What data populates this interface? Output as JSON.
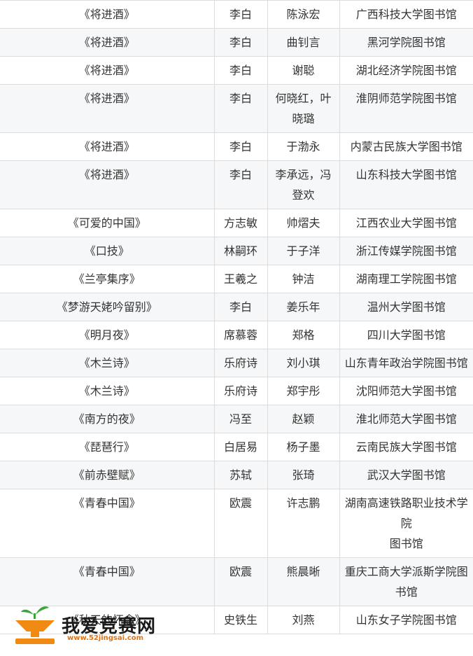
{
  "table": {
    "rows": [
      {
        "title": "《将进酒》",
        "author": "李白",
        "reader": "陈泳宏",
        "library": "广西科技大学图书馆"
      },
      {
        "title": "《将进酒》",
        "author": "李白",
        "reader": "曲钊言",
        "library": "黑河学院图书馆"
      },
      {
        "title": "《将进酒》",
        "author": "李白",
        "reader": "谢聪",
        "library": "湖北经济学院图书馆"
      },
      {
        "title": "《将进酒》",
        "author": "李白",
        "reader": "何晓红，叶晓璐",
        "library": "淮阴师范学院图书馆"
      },
      {
        "title": "《将进酒》",
        "author": "李白",
        "reader": "于渤永",
        "library": "内蒙古民族大学图书馆"
      },
      {
        "title": "《将进酒》",
        "author": "李白",
        "reader": "李承远，冯登欢",
        "library": "山东科技大学图书馆"
      },
      {
        "title": "《可爱的中国》",
        "author": "方志敏",
        "reader": "帅熠夫",
        "library": "江西农业大学图书馆"
      },
      {
        "title": "《口技》",
        "author": "林嗣环",
        "reader": "于子洋",
        "library": "浙江传媒学院图书馆"
      },
      {
        "title": "《兰亭集序》",
        "author": "王羲之",
        "reader": "钟洁",
        "library": "湖南理工学院图书馆"
      },
      {
        "title": "《梦游天姥吟留别》",
        "author": "李白",
        "reader": "姜乐年",
        "library": "温州大学图书馆"
      },
      {
        "title": "《明月夜》",
        "author": "席慕蓉",
        "reader": "郑格",
        "library": "四川大学图书馆"
      },
      {
        "title": "《木兰诗》",
        "author": "乐府诗",
        "reader": "刘小琪",
        "library": "山东青年政治学院图书馆"
      },
      {
        "title": "《木兰诗》",
        "author": "乐府诗",
        "reader": "郑宇彤",
        "library": "沈阳师范大学图书馆"
      },
      {
        "title": "《南方的夜》",
        "author": "冯至",
        "reader": "赵颖",
        "library": "淮北师范大学图书馆"
      },
      {
        "title": "《琵琶行》",
        "author": "白居易",
        "reader": "杨子墨",
        "library": "云南民族大学图书馆"
      },
      {
        "title": "《前赤壁赋》",
        "author": "苏轼",
        "reader": "张琦",
        "library": "武汉大学图书馆"
      },
      {
        "title": "《青春中国》",
        "author": "欧震",
        "reader": "许志鹏",
        "library": "湖南高速铁路职业技术学院\n图书馆"
      },
      {
        "title": "《青春中国》",
        "author": "欧震",
        "reader": "熊晨晰",
        "library": "重庆工商大学派斯学院图书馆"
      },
      {
        "title": "《秋天的怀念》",
        "author": "史铁生",
        "reader": "刘燕",
        "library": "山东女子学院图书馆"
      }
    ]
  },
  "watermark": {
    "brand": "我爱竞赛网",
    "url": "www.52jingsai.com",
    "colors": {
      "orange": "#f08a12",
      "green": "#3aa53a",
      "dark": "#1a1a1a"
    }
  }
}
